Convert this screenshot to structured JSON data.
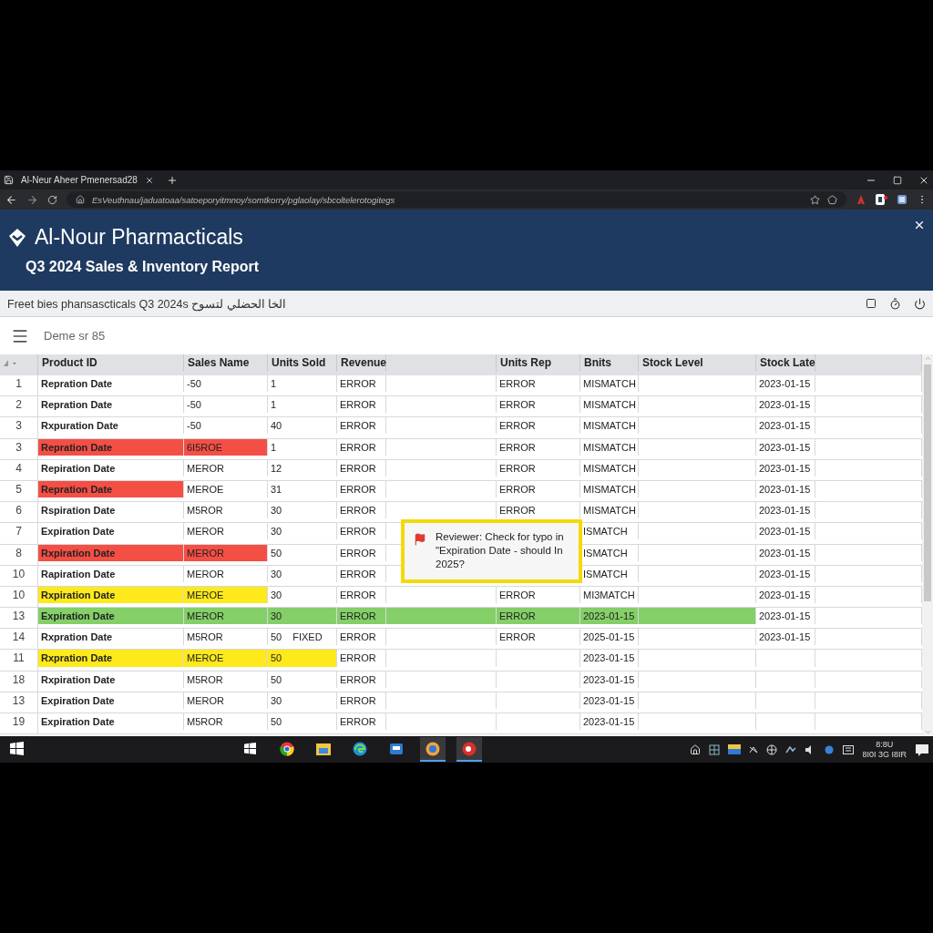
{
  "browser": {
    "tab_title": "Al-Neur Aheer Pmenersad28",
    "url": "EsVeuthnau/jaduatoaa/satoeporyitmnoy/somtkorry/pglaolay/sbcoltelerotogitegs"
  },
  "header": {
    "company": "Al-Nour Pharmacticals",
    "report_title": "Q3 2024 Sales & Inventory Report"
  },
  "subheader": {
    "text": "Freet bies phansascticals  Q3 2024s الخا الحضلي لتسوح"
  },
  "toolbar": {
    "title": "Deme sr 85"
  },
  "table": {
    "columns": [
      "Product ID",
      "Sales Name",
      "Units Sold",
      "Revenue",
      null,
      "Units Rep",
      "Bnits",
      "Stock Level",
      "Stock Late",
      null
    ],
    "rows": [
      {
        "number": "1",
        "cells": [
          {
            "text": "Repration Date"
          },
          {
            "text": "-50"
          },
          {
            "text": "1"
          },
          {
            "text": "ERROR"
          },
          {},
          {
            "text": "ERROR"
          },
          {
            "text": "MISMATCH"
          },
          {},
          {
            "text": "2023-01-15"
          },
          {}
        ]
      },
      {
        "number": "2",
        "cells": [
          {
            "text": "Repration Date"
          },
          {
            "text": "-50"
          },
          {
            "text": "1"
          },
          {
            "text": "ERROR"
          },
          {},
          {
            "text": "ERROR"
          },
          {
            "text": "MISMATCH"
          },
          {},
          {
            "text": "2023-01-15"
          },
          {}
        ]
      },
      {
        "number": "3",
        "cells": [
          {
            "text": "Rxpuration Date"
          },
          {
            "text": "-50"
          },
          {
            "text": "40"
          },
          {
            "text": "ERROR"
          },
          {},
          {
            "text": "ERROR"
          },
          {
            "text": "MISMATCH"
          },
          {},
          {
            "text": "2023-01-15"
          },
          {}
        ]
      },
      {
        "number": "3",
        "cells": [
          {
            "text": "Repration Date",
            "color": "#f44f45"
          },
          {
            "text": "6I5ROE",
            "color": "#f44f45"
          },
          {
            "text": "1"
          },
          {
            "text": "ERROR"
          },
          {},
          {
            "text": "ERROR"
          },
          {
            "text": "MISMATCH"
          },
          {},
          {
            "text": "2023-01-15"
          },
          {}
        ]
      },
      {
        "number": "4",
        "cells": [
          {
            "text": "Repiration Date"
          },
          {
            "text": "MEROR"
          },
          {
            "text": "12"
          },
          {
            "text": "ERROR"
          },
          {},
          {
            "text": "ERROR"
          },
          {
            "text": "MISMATCH"
          },
          {},
          {
            "text": "2023-01-15"
          },
          {}
        ]
      },
      {
        "number": "5",
        "cells": [
          {
            "text": "Repration Date",
            "color": "#f44f45"
          },
          {
            "text": "MEROE"
          },
          {
            "text": "31"
          },
          {
            "text": "ERROR"
          },
          {},
          {
            "text": "ERROR"
          },
          {
            "text": "MISMATCH"
          },
          {},
          {
            "text": "2023-01-15"
          },
          {}
        ]
      },
      {
        "number": "6",
        "cells": [
          {
            "text": "Rspiration Date"
          },
          {
            "text": "M5ROR"
          },
          {
            "text": "30"
          },
          {
            "text": "ERROR"
          },
          {},
          {
            "text": "ERROR"
          },
          {
            "text": "MISMATCH"
          },
          {},
          {
            "text": "2023-01-15"
          },
          {}
        ]
      },
      {
        "number": "7",
        "cells": [
          {
            "text": "Expiration Date"
          },
          {
            "text": "MEROR"
          },
          {
            "text": "30"
          },
          {
            "text": "ERROR"
          },
          {},
          {},
          {
            "text": "ISMATCH"
          },
          {},
          {
            "text": "2023-01-15"
          },
          {}
        ]
      },
      {
        "number": "8",
        "cells": [
          {
            "text": "Rxpiration Date",
            "color": "#f44f45"
          },
          {
            "text": "MEROR",
            "color": "#f44f45"
          },
          {
            "text": "50"
          },
          {
            "text": "ERROR"
          },
          {},
          {},
          {
            "text": "ISMATCH"
          },
          {},
          {
            "text": "2023-01-15"
          },
          {}
        ]
      },
      {
        "number": "10",
        "cells": [
          {
            "text": "Rapiration Date"
          },
          {
            "text": "MEROR"
          },
          {
            "text": "30"
          },
          {
            "text": "ERROR"
          },
          {},
          {},
          {
            "text": "ISMATCH"
          },
          {},
          {
            "text": "2023-01-15"
          },
          {}
        ]
      },
      {
        "number": "10",
        "cells": [
          {
            "text": "Rxpiration Date",
            "color": "#fde91c"
          },
          {
            "text": "MEROE",
            "color": "#fde91c"
          },
          {
            "text": "30"
          },
          {
            "text": "ERROR"
          },
          {},
          {
            "text": "ERROR"
          },
          {
            "text": "MI3MATCH"
          },
          {},
          {
            "text": "2023-01-15"
          },
          {}
        ]
      },
      {
        "number": "13",
        "cells": [
          {
            "text": "Expiration Date",
            "color": "#84cf68"
          },
          {
            "text": "MEROR",
            "color": "#84cf68"
          },
          {
            "text": "30",
            "color": "#84cf68"
          },
          {
            "text": "ERROR",
            "color": "#84cf68"
          },
          {
            "color": "#84cf68"
          },
          {
            "text": "ERROR",
            "color": "#84cf68"
          },
          {
            "text": "2023-01-15",
            "color": "#84cf68"
          },
          {
            "color": "#84cf68"
          },
          {
            "text": "2023-01-15"
          },
          {}
        ]
      },
      {
        "number": "14",
        "cells": [
          {
            "text": "Rxpration Date"
          },
          {
            "text": "M5ROR"
          },
          {
            "text": "50",
            "status": "FIXED"
          },
          {
            "text": "ERROR"
          },
          {},
          {
            "text": "ERROR"
          },
          {
            "text": "2025-01-15"
          },
          {},
          {
            "text": "2023-01-15"
          },
          {}
        ]
      },
      {
        "number": "11",
        "cells": [
          {
            "text": "Rxpration Date",
            "color": "#fde91c"
          },
          {
            "text": "MEROE",
            "color": "#fde91c"
          },
          {
            "text": "50",
            "color": "#fde91c"
          },
          {
            "text": "ERROR"
          },
          {},
          {},
          {
            "text": "2023-01-15"
          },
          {},
          {},
          {}
        ]
      },
      {
        "number": "18",
        "cells": [
          {
            "text": "Rxpiration Date"
          },
          {
            "text": "M5ROR"
          },
          {
            "text": "50"
          },
          {
            "text": "ERROR"
          },
          {},
          {},
          {
            "text": "2023-01-15"
          },
          {},
          {},
          {}
        ]
      },
      {
        "number": "13",
        "cells": [
          {
            "text": "Expiration Date"
          },
          {
            "text": "MEROR"
          },
          {
            "text": "30"
          },
          {
            "text": "ERROR"
          },
          {},
          {},
          {
            "text": "2023-01-15"
          },
          {},
          {},
          {}
        ]
      },
      {
        "number": "19",
        "cells": [
          {
            "text": "Expiration Date"
          },
          {
            "text": "M5ROR"
          },
          {
            "text": "50"
          },
          {
            "text": "ERROR"
          },
          {},
          {},
          {
            "text": "2023-01-15"
          },
          {},
          {},
          {}
        ]
      }
    ]
  },
  "comment": {
    "text": "Reviewer: Check for typo in \"Expiration Date - should In 2025?"
  },
  "taskbar": {
    "time": "8:8U",
    "date": "8I0I 3G I8IR"
  }
}
